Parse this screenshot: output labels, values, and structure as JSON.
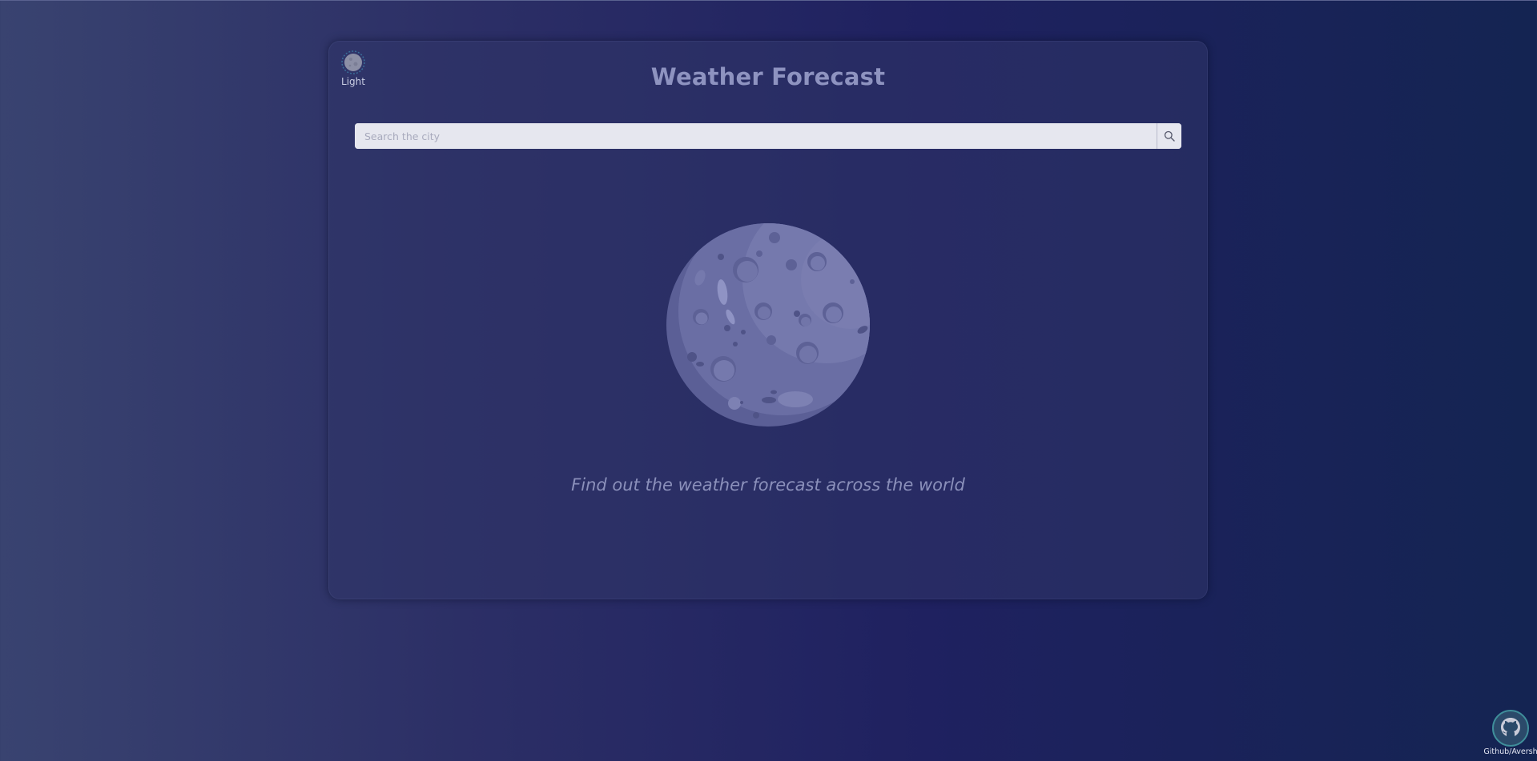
{
  "app": {
    "title": "Weather Forecast"
  },
  "theme_toggle": {
    "label": "Light",
    "icon": "moon-icon"
  },
  "search": {
    "placeholder": "Search the city",
    "value": "",
    "button_icon": "search-icon"
  },
  "hero": {
    "illustration": "moon-illustration",
    "tagline": "Find out the weather forecast across the world"
  },
  "footer": {
    "github_label": "Github/Aversh",
    "icon": "github-icon"
  },
  "colors": {
    "background_start": "#394370",
    "background_end": "#142452",
    "title": "#8e93c0",
    "moon": "#6f74a8",
    "search_bg": "#e6e7ef"
  }
}
